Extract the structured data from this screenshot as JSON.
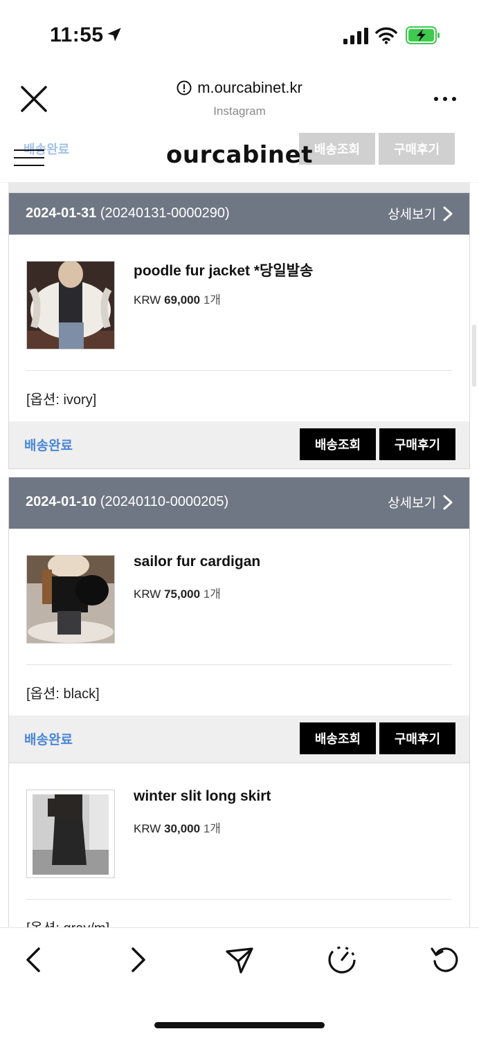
{
  "status_bar": {
    "time": "11:55",
    "icons": [
      "location-arrow-icon",
      "cellular-signal-icon",
      "wifi-icon",
      "battery-charging-icon"
    ],
    "battery_color": "#3ecb4d"
  },
  "browser": {
    "url": "m.ourcabinet.kr",
    "subtitle": "Instagram",
    "icons": [
      "close-icon",
      "info-icon",
      "more-icon"
    ]
  },
  "site": {
    "logo": "ourcabinet",
    "ghost_status": "배송완료",
    "ghost_track": "배송조회",
    "ghost_review": "구매후기"
  },
  "orders": [
    {
      "date": "2024-01-31",
      "order_no": "(20240131-0000290)",
      "detail_label": "상세보기",
      "item": {
        "name": "poodle fur jacket *당일발송",
        "currency": "KRW",
        "price": "69,000",
        "qty": "1개",
        "option": "[옵션: ivory]"
      },
      "status": "배송완료",
      "track_label": "배송조회",
      "review_label": "구매후기"
    },
    {
      "date": "2024-01-10",
      "order_no": "(20240110-0000205)",
      "detail_label": "상세보기",
      "item": {
        "name": "sailor fur cardigan",
        "currency": "KRW",
        "price": "75,000",
        "qty": "1개",
        "option": "[옵션: black]"
      },
      "status": "배송완료",
      "track_label": "배송조회",
      "review_label": "구매후기"
    },
    {
      "item": {
        "name": "winter slit long skirt",
        "currency": "KRW",
        "price": "30,000",
        "qty": "1개",
        "option": "[옵션: gray/m]"
      }
    }
  ],
  "colors": {
    "order_header": "#707784",
    "status_blue": "#4a86d6",
    "button_black": "#000000"
  },
  "toolbar": {
    "icons": [
      "back-icon",
      "forward-icon",
      "share-icon",
      "speed-icon",
      "reload-icon"
    ]
  }
}
